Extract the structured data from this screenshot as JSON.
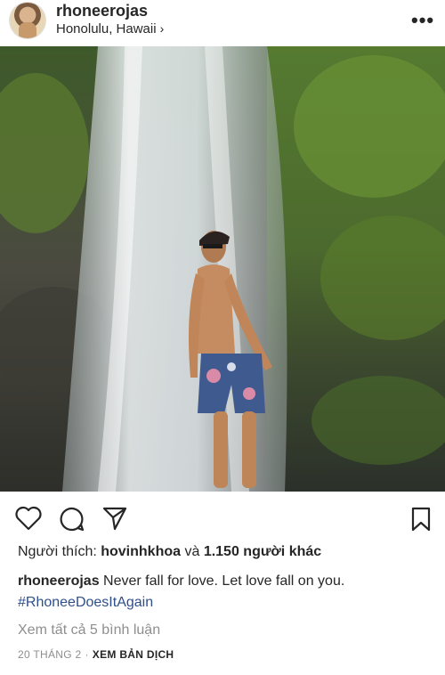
{
  "post": {
    "username": "rhoneerojas",
    "location": "Honolulu, Hawaii",
    "location_chevron": "›",
    "more_glyph": "•••"
  },
  "actions": {
    "icons": [
      "heart-icon",
      "comment-icon",
      "share-icon",
      "bookmark-icon"
    ]
  },
  "likes": {
    "prefix": "Người thích: ",
    "user": "hovinhkhoa",
    "middle": " và ",
    "others": "1.150 người khác"
  },
  "caption": {
    "username": "rhoneerojas",
    "text": " Never fall for love. Let love fall on you.",
    "hashtag": "#RhoneeDoesItAgain"
  },
  "comments": {
    "view_all": "Xem tất cả 5 bình luận"
  },
  "meta": {
    "date": "20 THÁNG 2",
    "dot": "·",
    "translate": "XEM BẢN DỊCH"
  },
  "colors": {
    "text": "#262626",
    "secondary": "#8e8e8e",
    "hashtag": "#2f4f8a"
  }
}
